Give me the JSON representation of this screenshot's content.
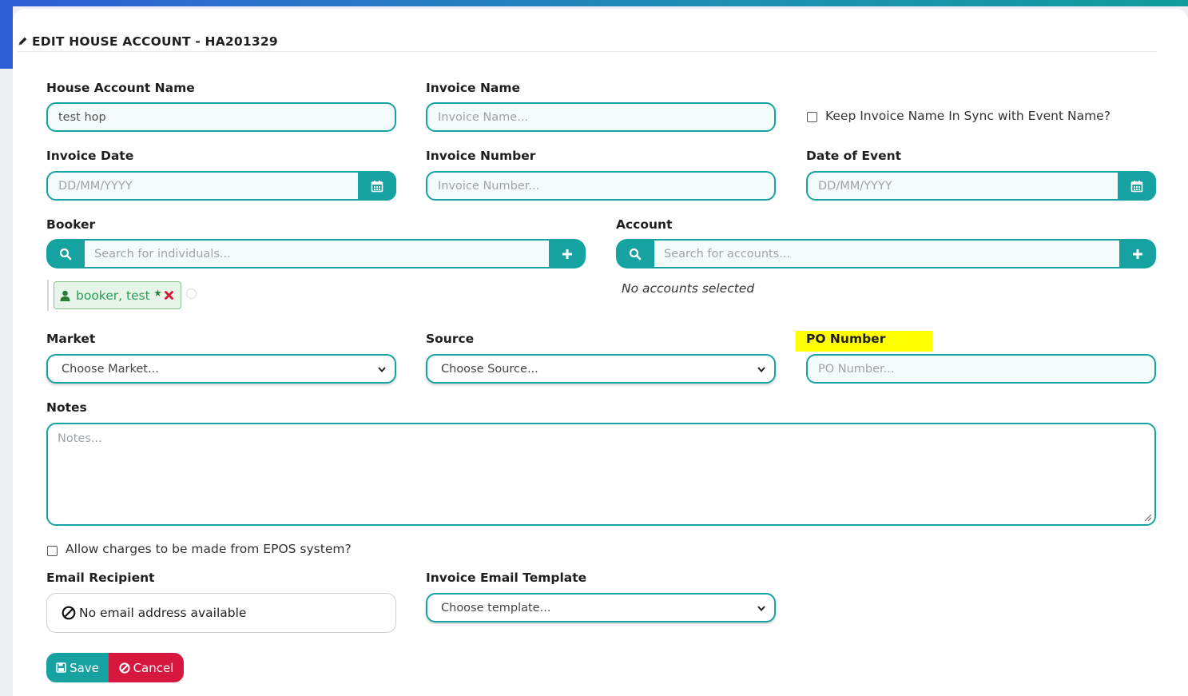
{
  "header": {
    "title": "EDIT HOUSE ACCOUNT - HA201329"
  },
  "form": {
    "house_account_name": {
      "label": "House Account Name",
      "value": "test hop"
    },
    "invoice_name": {
      "label": "Invoice Name",
      "placeholder": "Invoice Name..."
    },
    "keep_sync": {
      "label": "Keep Invoice Name In Sync with Event Name?",
      "checked": false
    },
    "invoice_date": {
      "label": "Invoice Date",
      "placeholder": "DD/MM/YYYY"
    },
    "invoice_number": {
      "label": "Invoice Number",
      "placeholder": "Invoice Number..."
    },
    "date_of_event": {
      "label": "Date of Event",
      "placeholder": "DD/MM/YYYY"
    },
    "booker": {
      "label": "Booker",
      "placeholder": "Search for individuals...",
      "selected": "booker, test"
    },
    "account": {
      "label": "Account",
      "placeholder": "Search for accounts...",
      "empty_text": "No accounts selected"
    },
    "market": {
      "label": "Market",
      "selected": "Choose Market..."
    },
    "source": {
      "label": "Source",
      "selected": "Choose Source..."
    },
    "po_number": {
      "label": "PO Number",
      "placeholder": "PO Number..."
    },
    "notes": {
      "label": "Notes",
      "placeholder": "Notes..."
    },
    "allow_epos": {
      "label": "Allow charges to be made from EPOS system?",
      "checked": false
    },
    "email_recipient": {
      "label": "Email Recipient",
      "value": "No email address available"
    },
    "invoice_email_template": {
      "label": "Invoice Email Template",
      "selected": "Choose template..."
    }
  },
  "buttons": {
    "save": "Save",
    "cancel": "Cancel"
  },
  "colors": {
    "accent": "#17a2a2",
    "danger": "#d6183f",
    "chip_text": "#2a9d56",
    "highlight": "#ffff00"
  }
}
